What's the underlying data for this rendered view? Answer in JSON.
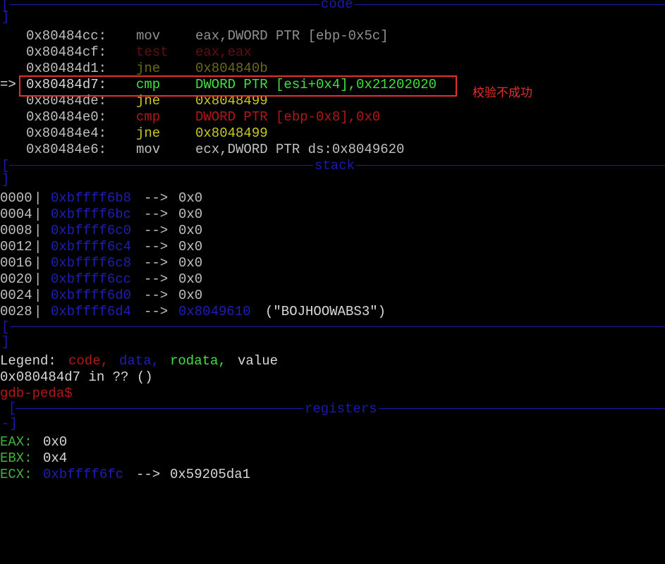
{
  "sections": {
    "code": "code",
    "stack": "stack",
    "registers": "registers"
  },
  "code_lines": [
    {
      "addr": "0x80484cc:",
      "op": "mov",
      "args": "eax,DWORD PTR [ebp-0x5c]",
      "marker": ""
    },
    {
      "addr": "0x80484cf:",
      "op": "test",
      "args": "eax,eax",
      "marker": ""
    },
    {
      "addr": "0x80484d1:",
      "op": "jne",
      "args": "0x804840b",
      "marker": ""
    },
    {
      "addr": "0x80484d7:",
      "op": "cmp",
      "args": "DWORD PTR [esi+0x4],0x21202020",
      "marker": "=>"
    },
    {
      "addr": "0x80484de:",
      "op": "jne",
      "args": "0x8048499",
      "marker": ""
    },
    {
      "addr": "0x80484e0:",
      "op": "cmp",
      "args": "DWORD PTR [ebp-0x8],0x0",
      "marker": ""
    },
    {
      "addr": "0x80484e4:",
      "op": "jne",
      "args": "0x8048499",
      "marker": ""
    },
    {
      "addr": "0x80484e6:",
      "op": "mov",
      "args": "ecx,DWORD PTR ds:0x8049620",
      "marker": ""
    }
  ],
  "annotation": "校验不成功",
  "stack_lines": [
    {
      "off": "0000",
      "addr": "0xbffff6b8",
      "arrow": "-->",
      "val": "0x0",
      "extra": ""
    },
    {
      "off": "0004",
      "addr": "0xbffff6bc",
      "arrow": "-->",
      "val": "0x0",
      "extra": ""
    },
    {
      "off": "0008",
      "addr": "0xbffff6c0",
      "arrow": "-->",
      "val": "0x0",
      "extra": ""
    },
    {
      "off": "0012",
      "addr": "0xbffff6c4",
      "arrow": "-->",
      "val": "0x0",
      "extra": ""
    },
    {
      "off": "0016",
      "addr": "0xbffff6c8",
      "arrow": "-->",
      "val": "0x0",
      "extra": ""
    },
    {
      "off": "0020",
      "addr": "0xbffff6cc",
      "arrow": "-->",
      "val": "0x0",
      "extra": ""
    },
    {
      "off": "0024",
      "addr": "0xbffff6d0",
      "arrow": "-->",
      "val": "0x0",
      "extra": ""
    },
    {
      "off": "0028",
      "addr": "0xbffff6d4",
      "arrow": "-->",
      "val": "0x8049610",
      "extra": "(\"BOJHOOWABS3\")"
    }
  ],
  "legend": {
    "prefix": "Legend:",
    "code": "code,",
    "data": "data,",
    "rodata": "rodata,",
    "value": "value"
  },
  "location": "0x080484d7 in ?? ()",
  "prompt": "gdb-peda$",
  "registers": [
    {
      "name": "EAX:",
      "val": "0x0",
      "ptr": "",
      "arrow": "",
      "target": ""
    },
    {
      "name": "EBX:",
      "val": "0x4",
      "ptr": "",
      "arrow": "",
      "target": ""
    },
    {
      "name": "ECX:",
      "val": "",
      "ptr": "0xbffff6fc",
      "arrow": "-->",
      "target": "0x59205da1"
    }
  ],
  "colors": {
    "separator": "#1a1ab0",
    "highlight_box": "#e8302a",
    "opcode_jump": "#c8c820",
    "opcode_current": "#40e040",
    "opcode_cmp": "#b01818",
    "register_name": "#40b040"
  }
}
